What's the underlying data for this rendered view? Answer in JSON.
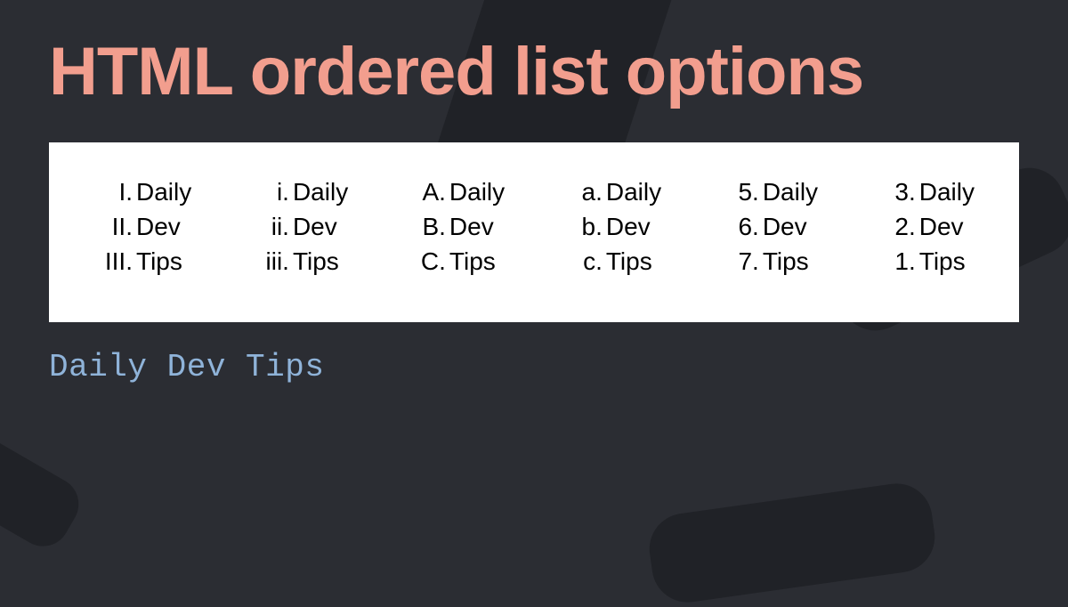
{
  "title": "HTML ordered list options",
  "footer": "Daily Dev Tips",
  "lists": [
    {
      "name": "upper-roman",
      "items": [
        {
          "marker": "I.",
          "label": "Daily"
        },
        {
          "marker": "II.",
          "label": "Dev"
        },
        {
          "marker": "III.",
          "label": "Tips"
        }
      ]
    },
    {
      "name": "lower-roman",
      "items": [
        {
          "marker": "i.",
          "label": "Daily"
        },
        {
          "marker": "ii.",
          "label": "Dev"
        },
        {
          "marker": "iii.",
          "label": "Tips"
        }
      ]
    },
    {
      "name": "upper-alpha",
      "items": [
        {
          "marker": "A.",
          "label": "Daily"
        },
        {
          "marker": "B.",
          "label": "Dev"
        },
        {
          "marker": "C.",
          "label": "Tips"
        }
      ]
    },
    {
      "name": "lower-alpha",
      "items": [
        {
          "marker": "a.",
          "label": "Daily"
        },
        {
          "marker": "b.",
          "label": "Dev"
        },
        {
          "marker": "c.",
          "label": "Tips"
        }
      ]
    },
    {
      "name": "decimal-start-5",
      "items": [
        {
          "marker": "5.",
          "label": "Daily"
        },
        {
          "marker": "6.",
          "label": "Dev"
        },
        {
          "marker": "7.",
          "label": "Tips"
        }
      ]
    },
    {
      "name": "decimal-reversed",
      "items": [
        {
          "marker": "3.",
          "label": "Daily"
        },
        {
          "marker": "2.",
          "label": "Dev"
        },
        {
          "marker": "1.",
          "label": "Tips"
        }
      ]
    }
  ],
  "colors": {
    "background": "#2b2d33",
    "title": "#f29e8e",
    "panel": "#ffffff",
    "footer": "#8fb3d9",
    "shapes": "#1d1e22"
  }
}
